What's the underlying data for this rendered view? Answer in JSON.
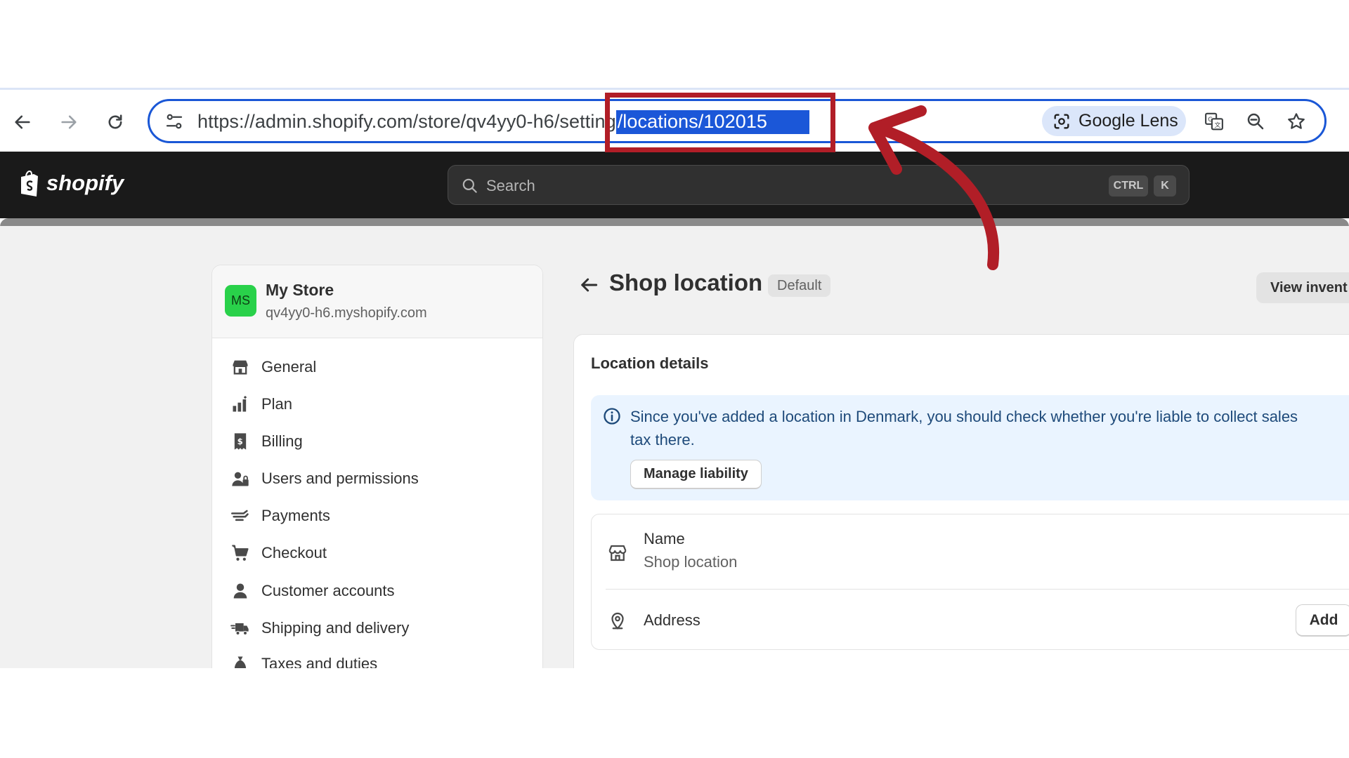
{
  "browser": {
    "url_prefix": "https://admin.shopify.com/store/qv4yy0-h6/setting",
    "url_selected": "/locations/102015",
    "lens_label": "Google Lens"
  },
  "shopify": {
    "logo_text": "shopify",
    "search_placeholder": "Search",
    "shortcut_ctrl": "CTRL",
    "shortcut_k": "K"
  },
  "store": {
    "avatar": "MS",
    "name": "My Store",
    "domain": "qv4yy0-h6.myshopify.com"
  },
  "sidebar": {
    "items": [
      {
        "label": "General",
        "icon": "store-icon"
      },
      {
        "label": "Plan",
        "icon": "plan-icon"
      },
      {
        "label": "Billing",
        "icon": "billing-icon"
      },
      {
        "label": "Users and permissions",
        "icon": "users-icon"
      },
      {
        "label": "Payments",
        "icon": "payments-icon"
      },
      {
        "label": "Checkout",
        "icon": "cart-icon"
      },
      {
        "label": "Customer accounts",
        "icon": "person-icon"
      },
      {
        "label": "Shipping and delivery",
        "icon": "truck-icon"
      },
      {
        "label": "Taxes and duties",
        "icon": "taxes-icon"
      }
    ]
  },
  "page": {
    "title": "Shop location",
    "badge": "Default",
    "view_inventory": "View invent"
  },
  "card": {
    "title": "Location details",
    "banner_text": "Since you've added a location in Denmark, you should check whether you're liable to collect sales tax there.",
    "banner_button": "Manage liability",
    "name_label": "Name",
    "name_value": "Shop location",
    "address_label": "Address",
    "add_button": "Add"
  },
  "annotation": {
    "color": "#b11e27"
  }
}
